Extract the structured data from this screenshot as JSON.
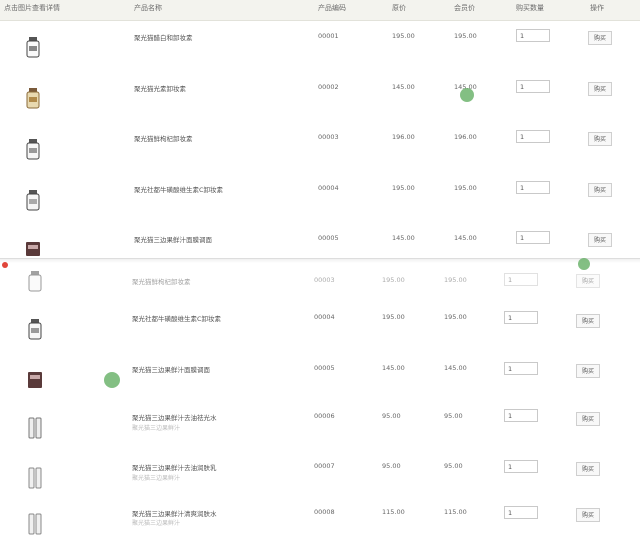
{
  "header": {
    "col_image": "点击图片查看详情",
    "col_name": "产品名称",
    "col_code": "产品编码",
    "col_price": "原价",
    "col_member_price": "会员价",
    "col_qty": "购买数量",
    "col_action": "操作"
  },
  "top_rows": [
    {
      "name": "聚光猫醋白和卸妆素",
      "code": "00001",
      "price": "195.00",
      "member": "195.00",
      "qty": "1",
      "action": "购买"
    },
    {
      "name": "聚光猫光素卸妆素",
      "code": "00002",
      "price": "145.00",
      "member": "145.00",
      "qty": "1",
      "action": "购买"
    },
    {
      "name": "聚光猫鲜枸杞卸妆素",
      "code": "00003",
      "price": "196.00",
      "member": "196.00",
      "qty": "1",
      "action": "购买"
    },
    {
      "name": "聚光社都牛磺酸维生素C卸妆素",
      "code": "00004",
      "price": "195.00",
      "member": "195.00",
      "qty": "1",
      "action": "购买"
    },
    {
      "name": "聚光猫三边果鲜汁面膜调面",
      "code": "00005",
      "price": "145.00",
      "member": "145.00",
      "qty": "1",
      "action": "购买"
    }
  ],
  "bottom_rows": [
    {
      "name": "聚光猫鲜枸杞卸妆素",
      "sub": "",
      "code": "00003",
      "price": "195.00",
      "member": "195.00",
      "qty": "1",
      "action": "购买"
    },
    {
      "name": "聚光社都牛磺酸维生素C卸妆素",
      "sub": "",
      "code": "00004",
      "price": "195.00",
      "member": "195.00",
      "qty": "1",
      "action": "购买"
    },
    {
      "name": "聚光猫三边果鲜汁面膜调面",
      "sub": "",
      "code": "00005",
      "price": "145.00",
      "member": "145.00",
      "qty": "1",
      "action": "购买"
    },
    {
      "name": "聚光猫三边果鲜汁去油祛光水",
      "sub": "聚光猫三边果鲜汁",
      "code": "00006",
      "price": "95.00",
      "member": "95.00",
      "qty": "1",
      "action": "购买"
    },
    {
      "name": "聚光猫三边果鲜汁去油润肤乳",
      "sub": "聚光猫三边果鲜汁",
      "code": "00007",
      "price": "95.00",
      "member": "95.00",
      "qty": "1",
      "action": "购买"
    },
    {
      "name": "聚光猫三边果鲜汁清爽润肤水",
      "sub": "聚光猫三边果鲜汁",
      "code": "00008",
      "price": "115.00",
      "member": "115.00",
      "qty": "1",
      "action": "购买"
    }
  ],
  "colors": {
    "header_bg": "#f3f3ee",
    "cursor": "#5aaa5a",
    "jar_beige": "#d9c9a0",
    "jar_brown": "#6b4a3a"
  }
}
